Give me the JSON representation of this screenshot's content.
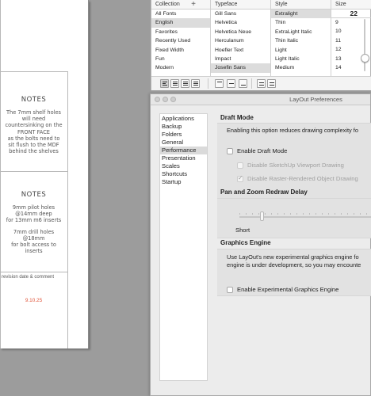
{
  "document": {
    "notes1": {
      "title": "NOTES",
      "lines": [
        "The 7mm shelf holes",
        "will need",
        "countersinking on the",
        "FRONT FACE",
        "as the bolts need to",
        "sit flush to the MDF",
        "behind the shelves"
      ]
    },
    "notes2": {
      "title": "NOTES",
      "lines_a": [
        "9mm pilot holes",
        "@14mm deep",
        "for 13mm m6 inserts"
      ],
      "lines_b": [
        "7mm drill holes",
        "@18mm",
        "for bolt access to",
        "inserts"
      ]
    },
    "revision": {
      "label": "revision date & comment",
      "date": "9.10.25"
    },
    "colors": {
      "revision_date": "#e0553a"
    }
  },
  "font_panel": {
    "columns": {
      "collection": "Collection",
      "typeface": "Typeface",
      "style": "Style",
      "size": "Size"
    },
    "add_symbol": "+",
    "collections": [
      "All Fonts",
      "English",
      "Favorites",
      "Recently Used",
      "Fixed Width",
      "Fun",
      "Modern"
    ],
    "selected_collection": "English",
    "typefaces": [
      "Gill Sans",
      "Helvetica",
      "Helvetica Neue",
      "Herculanum",
      "Hoefler Text",
      "Impact",
      "Josefin Sans"
    ],
    "selected_typeface": "Josefin Sans",
    "styles": [
      "Extralight",
      "Thin",
      "ExtraLight Italic",
      "Thin Italic",
      "Light",
      "Light Italic",
      "Medium"
    ],
    "selected_style": "Extralight",
    "size_value": "22",
    "sizes": [
      "9",
      "10",
      "11",
      "12",
      "13",
      "14"
    ]
  },
  "preferences": {
    "title": "LayOut Preferences",
    "categories": [
      "Applications",
      "Backup",
      "Folders",
      "General",
      "Performance",
      "Presentation",
      "Scales",
      "Shortcuts",
      "Startup"
    ],
    "selected_category": "Performance",
    "draft_mode": {
      "heading": "Draft Mode",
      "description": "Enabling this option reduces drawing complexity fo",
      "enable_label": "Enable Draft Mode",
      "sketchup_label": "Disable SketchUp Viewport Drawing",
      "raster_label": "Disable Raster-Rendered Object Drawing"
    },
    "pan_zoom": {
      "heading": "Pan and Zoom Redraw Delay",
      "slider_label": "Short",
      "slider_level": 0.15
    },
    "graphics": {
      "heading": "Graphics Engine",
      "desc_line1": "Use LayOut's new experimental graphics engine fo",
      "desc_line2": "engine is under development, so you may encounte",
      "enable_label": "Enable Experimental Graphics Engine"
    }
  }
}
